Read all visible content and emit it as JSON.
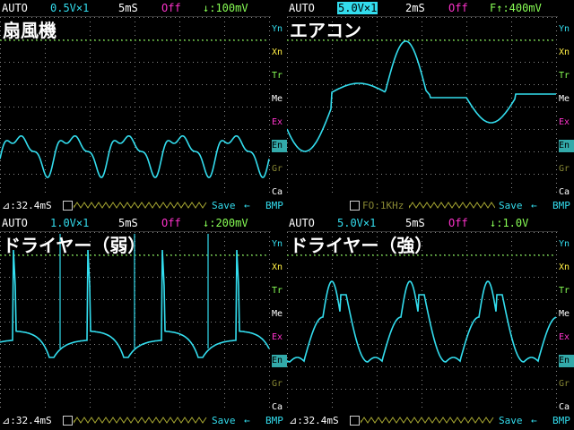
{
  "colors": {
    "trace": "#33ddee",
    "grid": "#888888",
    "trigger_line": "#88ff55",
    "menu_ex": "#ff33cc",
    "menu_en": "#33aaaa",
    "menu_gr": "#888833",
    "menu_xn": "#ffee44"
  },
  "panels": [
    {
      "title": "扇風機",
      "status": {
        "mode": "AUTO",
        "vdiv": "0.5V×1",
        "tdiv": "5mS",
        "offset": "Off",
        "trigger": "↓:100mV",
        "vdiv_highlight": false
      },
      "footer": {
        "delta": "⊿:32.4mS",
        "save": "Save",
        "arrow": "←",
        "format": "BMP"
      },
      "menu": [
        "Yn",
        "Xn",
        "Tr",
        "Me",
        "Ex",
        "En",
        "Gr",
        "Ca"
      ],
      "trace_shape": "fan"
    },
    {
      "title": "エアコン",
      "status": {
        "mode": "AUTO",
        "vdiv": "5.0V×1",
        "tdiv": "2mS",
        "offset": "Off",
        "trigger": "F↑:400mV",
        "vdiv_highlight": true
      },
      "footer": {
        "delta": "",
        "save": "Save",
        "arrow": "←",
        "format": "BMP",
        "freq": "FO:1KHz"
      },
      "menu": [
        "Yn",
        "Xn",
        "Tr",
        "Me",
        "Ex",
        "En",
        "Gr",
        "Ca"
      ],
      "trace_shape": "aircon"
    },
    {
      "title": "ドライヤー（弱）",
      "status": {
        "mode": "AUTO",
        "vdiv": "1.0V×1",
        "tdiv": "5mS",
        "offset": "Off",
        "trigger": "↓:200mV",
        "vdiv_highlight": false
      },
      "footer": {
        "delta": "⊿:32.4mS",
        "save": "Save",
        "arrow": "←",
        "format": "BMP"
      },
      "menu": [
        "Yn",
        "Xn",
        "Tr",
        "Me",
        "Ex",
        "En",
        "Gr",
        "Ca"
      ],
      "trace_shape": "dryer_low"
    },
    {
      "title": "ドライヤー（強）",
      "status": {
        "mode": "AUTO",
        "vdiv": "5.0V×1",
        "tdiv": "5mS",
        "offset": "Off",
        "trigger": "↓:1.0V",
        "vdiv_highlight": false
      },
      "footer": {
        "delta": "⊿:32.4mS",
        "save": "Save",
        "arrow": "←",
        "format": "BMP"
      },
      "menu": [
        "Yn",
        "Xn",
        "Tr",
        "Me",
        "Ex",
        "En",
        "Gr",
        "Ca"
      ],
      "trace_shape": "dryer_high"
    }
  ]
}
